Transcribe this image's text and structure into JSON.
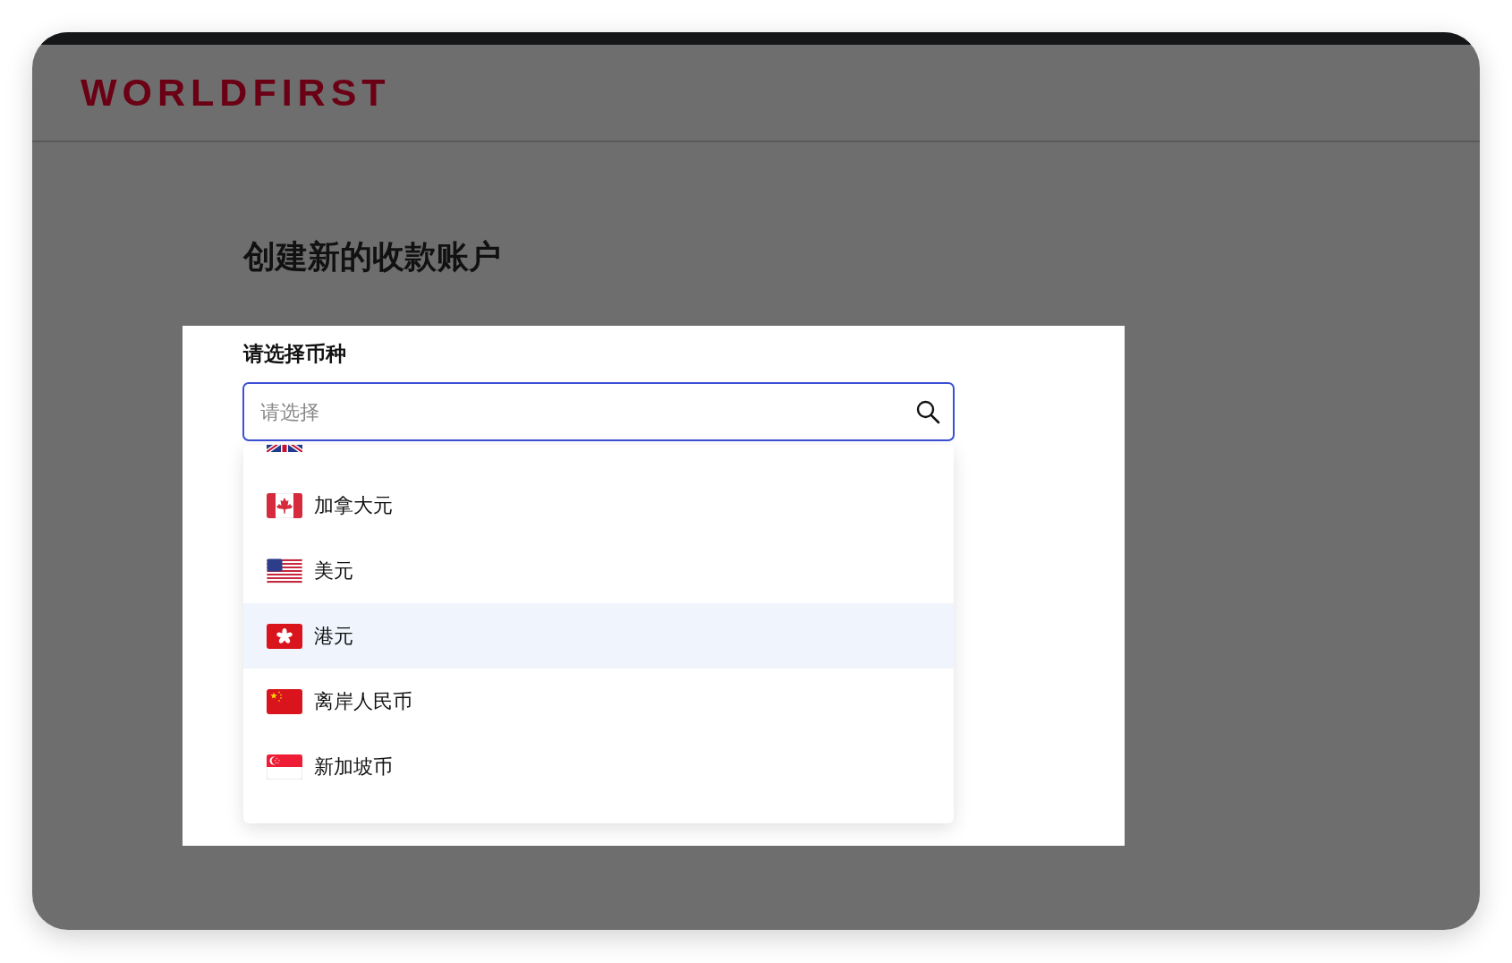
{
  "brand": {
    "logo": "WORLDFIRST"
  },
  "page": {
    "title": "创建新的收款账户"
  },
  "currency_field": {
    "label": "请选择币种",
    "placeholder": "请选择"
  },
  "options": [
    {
      "kind": "canada",
      "label": "加拿大元",
      "selected": false
    },
    {
      "kind": "usa",
      "label": "美元",
      "selected": false
    },
    {
      "kind": "hongkong",
      "label": "港元",
      "selected": true
    },
    {
      "kind": "china",
      "label": "离岸人民币",
      "selected": false
    },
    {
      "kind": "singapore",
      "label": "新加坡币",
      "selected": false
    }
  ]
}
